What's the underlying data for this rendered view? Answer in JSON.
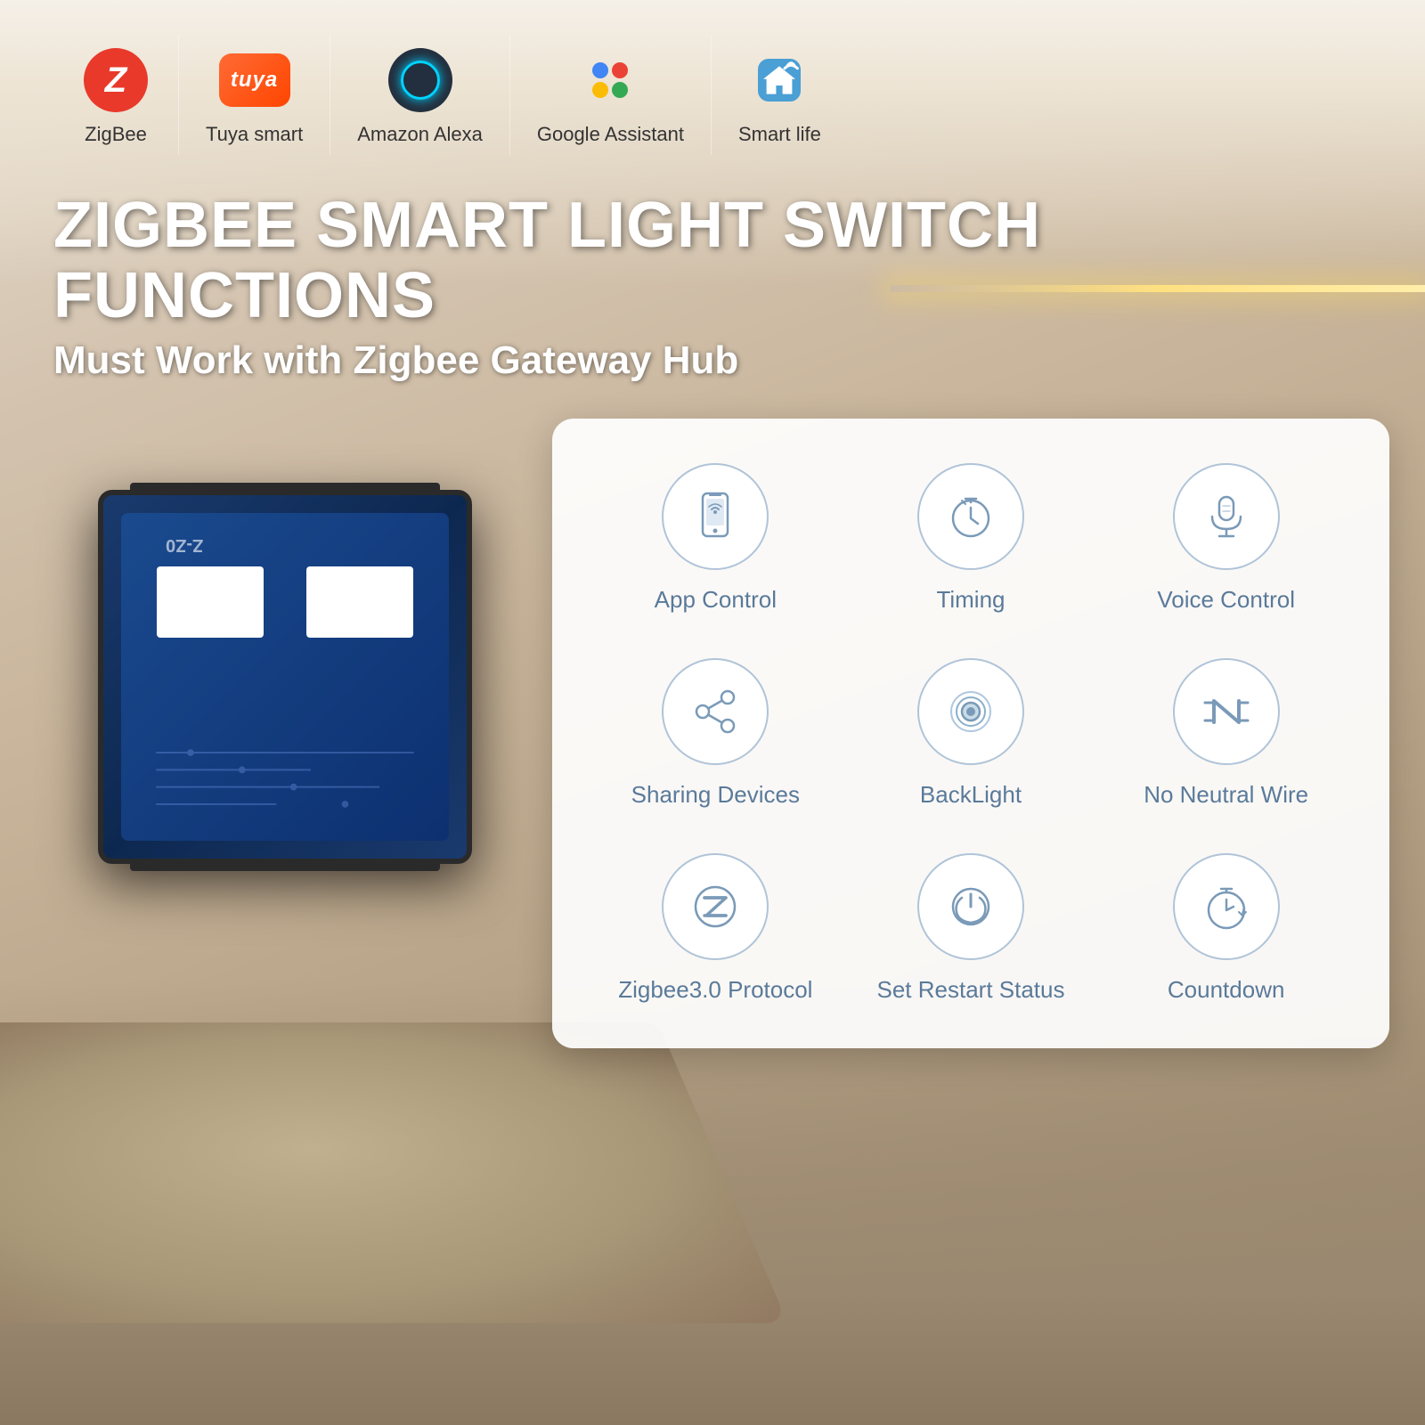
{
  "background": {
    "color1": "#e8ddd0",
    "color2": "#c8b49a"
  },
  "logos": [
    {
      "id": "zigbee",
      "label": "ZigBee",
      "type": "zigbee"
    },
    {
      "id": "tuya",
      "label": "Tuya smart",
      "type": "tuya"
    },
    {
      "id": "alexa",
      "label": "Amazon Alexa",
      "type": "alexa"
    },
    {
      "id": "google",
      "label": "Google Assistant",
      "type": "google"
    },
    {
      "id": "smartlife",
      "label": "Smart life",
      "type": "smartlife"
    }
  ],
  "headline": {
    "main": "ZIGBEE SMART LIGHT SWITCH FUNCTIONS",
    "sub": "Must Work with Zigbee Gateway Hub"
  },
  "features": [
    {
      "id": "app-control",
      "label": "App Control",
      "icon": "phone"
    },
    {
      "id": "timing",
      "label": "Timing",
      "icon": "clock"
    },
    {
      "id": "voice-control",
      "label": "Voice Control",
      "icon": "mic"
    },
    {
      "id": "sharing-devices",
      "label": "Sharing Devices",
      "icon": "share"
    },
    {
      "id": "backlight",
      "label": "BackLight",
      "icon": "backlight"
    },
    {
      "id": "no-neutral-wire",
      "label": "No Neutral Wire",
      "icon": "neutral"
    },
    {
      "id": "zigbee-protocol",
      "label": "Zigbee3.0 Protocol",
      "icon": "zigbee"
    },
    {
      "id": "set-restart-status",
      "label": "Set Restart Status",
      "icon": "power"
    },
    {
      "id": "countdown",
      "label": "Countdown",
      "icon": "countdown"
    }
  ]
}
